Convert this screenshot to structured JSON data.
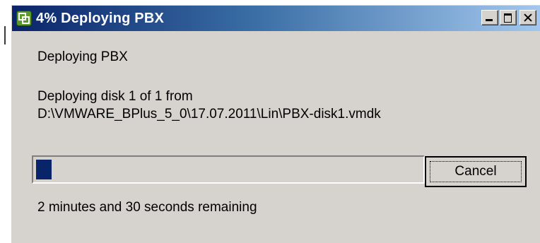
{
  "window": {
    "title": "4% Deploying PBX",
    "title_icon": "vsphere-app-icon",
    "caption_buttons": [
      "minimize",
      "maximize",
      "close"
    ]
  },
  "dialog": {
    "heading": "Deploying PBX",
    "detail_line1": "Deploying disk 1 of 1 from",
    "detail_line2": "D:\\VMWARE_BPlus_5_0\\17.07.2011\\Lin\\PBX-disk1.vmdk",
    "progress_percent": 4,
    "cancel_label": "Cancel",
    "remaining": "2 minutes and 30 seconds remaining"
  },
  "colors": {
    "titlebar_start": "#0a246a",
    "titlebar_end": "#a6caf0",
    "dialog_bg": "#d6d3ce",
    "progress_fill": "#0a246a"
  }
}
